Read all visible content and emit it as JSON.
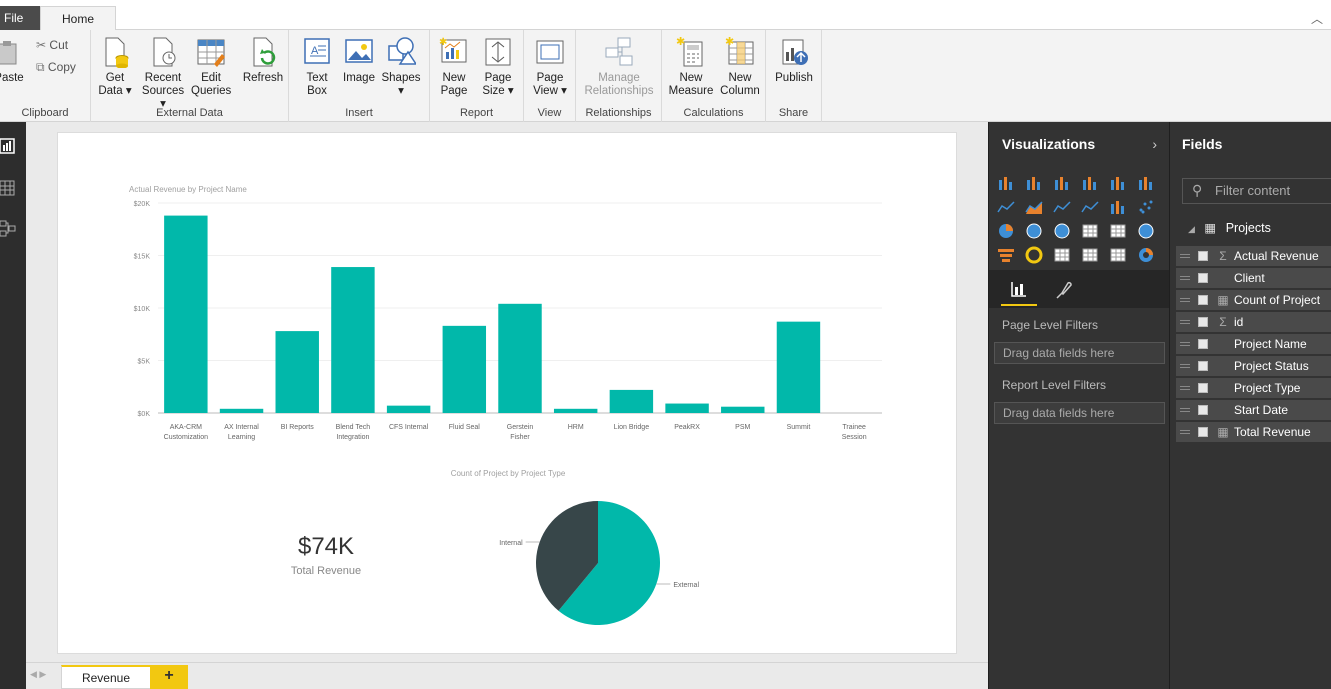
{
  "tabs": {
    "file": "File",
    "home": "Home"
  },
  "ribbon": {
    "clipboard": {
      "label": "Clipboard",
      "paste": "Paste",
      "cut": "Cut",
      "copy": "Copy"
    },
    "external_data": {
      "label": "External Data",
      "get_data": [
        "Get",
        "Data ▾"
      ],
      "recent_sources": [
        "Recent",
        "Sources ▾"
      ],
      "edit_queries": [
        "Edit",
        "Queries"
      ],
      "refresh": "Refresh"
    },
    "insert": {
      "label": "Insert",
      "text_box": [
        "Text",
        "Box"
      ],
      "image": "Image",
      "shapes": [
        "Shapes",
        "▾"
      ]
    },
    "report": {
      "label": "Report",
      "new_page": [
        "New",
        "Page"
      ],
      "page_size": [
        "Page",
        "Size ▾"
      ]
    },
    "view": {
      "label": "View",
      "page_view": [
        "Page",
        "View ▾"
      ]
    },
    "relationships": {
      "label": "Relationships",
      "manage": [
        "Manage",
        "Relationships"
      ]
    },
    "calculations": {
      "label": "Calculations",
      "new_measure": [
        "New",
        "Measure"
      ],
      "new_column": [
        "New",
        "Column"
      ]
    },
    "share": {
      "label": "Share",
      "publish": "Publish"
    }
  },
  "colors": {
    "teal": "#01b8aa",
    "dark": "#374649",
    "accent": "#f2c811"
  },
  "bar_chart": {
    "chart_data": {
      "type": "bar",
      "title": "Actual Revenue by Project Name",
      "categories": [
        [
          "AKA-CRM",
          "Customization"
        ],
        [
          "AX Internal",
          "Learning"
        ],
        [
          "BI Reports"
        ],
        [
          "Blend Tech",
          "Integration"
        ],
        [
          "CFS Internal"
        ],
        [
          "Fluid Seal"
        ],
        [
          "Gerstein",
          "Fisher"
        ],
        [
          "HRM"
        ],
        [
          "Lion Bridge"
        ],
        [
          "PeakRX"
        ],
        [
          "PSM"
        ],
        [
          "Summit"
        ],
        [
          "Trainee",
          "Session"
        ]
      ],
      "values": [
        18800,
        400,
        7800,
        13900,
        700,
        8300,
        10400,
        400,
        2200,
        900,
        600,
        8700,
        0
      ],
      "ylim": [
        0,
        20000
      ],
      "yticks": [
        "$0K",
        "$5K",
        "$10K",
        "$15K",
        "$20K"
      ],
      "ytick_values": [
        0,
        5000,
        10000,
        15000,
        20000
      ],
      "grid": true
    }
  },
  "pie_chart": {
    "chart_data": {
      "type": "pie",
      "title": "Count of Project by Project Type",
      "slices": [
        {
          "label": "External",
          "value": 61
        },
        {
          "label": "Internal",
          "value": 39
        }
      ]
    }
  },
  "card": {
    "value": "$74K",
    "label": "Total Revenue"
  },
  "pages": {
    "current": "Revenue",
    "add": "+"
  },
  "visualizations": {
    "title": "Visualizations",
    "page_filters": "Page Level Filters",
    "report_filters": "Report Level Filters",
    "drop_hint": "Drag data fields here"
  },
  "fields": {
    "title": "Fields",
    "search_placeholder": "Filter content",
    "table": "Projects",
    "items": [
      {
        "name": "Actual Revenue",
        "type": "Σ"
      },
      {
        "name": "Client",
        "type": ""
      },
      {
        "name": "Count of Project",
        "type": "▦"
      },
      {
        "name": "id",
        "type": "Σ"
      },
      {
        "name": "Project Name",
        "type": ""
      },
      {
        "name": "Project Status",
        "type": ""
      },
      {
        "name": "Project Type",
        "type": ""
      },
      {
        "name": "Start Date",
        "type": ""
      },
      {
        "name": "Total Revenue",
        "type": "▦"
      }
    ]
  }
}
